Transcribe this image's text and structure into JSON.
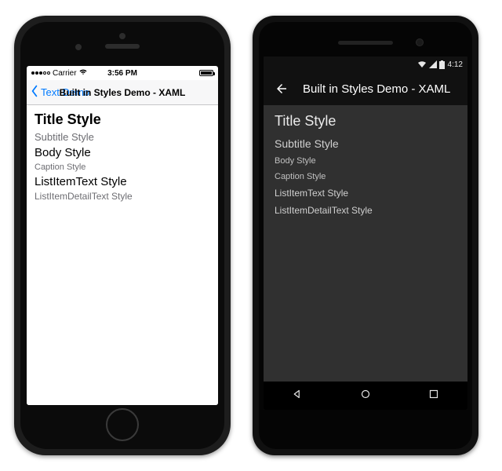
{
  "ios": {
    "status": {
      "carrier": "Carrier",
      "wifi_icon": "wifi",
      "time": "3:56 PM"
    },
    "nav": {
      "back_label": "Text Demo",
      "title": "Built in Styles Demo - XAML"
    },
    "styles": {
      "title": "Title Style",
      "subtitle": "Subtitle Style",
      "body": "Body Style",
      "caption": "Caption Style",
      "list_item": "ListItemText Style",
      "list_detail": "ListItemDetailText Style"
    }
  },
  "android": {
    "status": {
      "time": "4:12"
    },
    "appbar": {
      "title": "Built in Styles Demo - XAML"
    },
    "styles": {
      "title": "Title Style",
      "subtitle": "Subtitle Style",
      "body": "Body Style",
      "caption": "Caption Style",
      "list_item": "ListItemText Style",
      "list_detail": "ListItemDetailText Style"
    }
  }
}
